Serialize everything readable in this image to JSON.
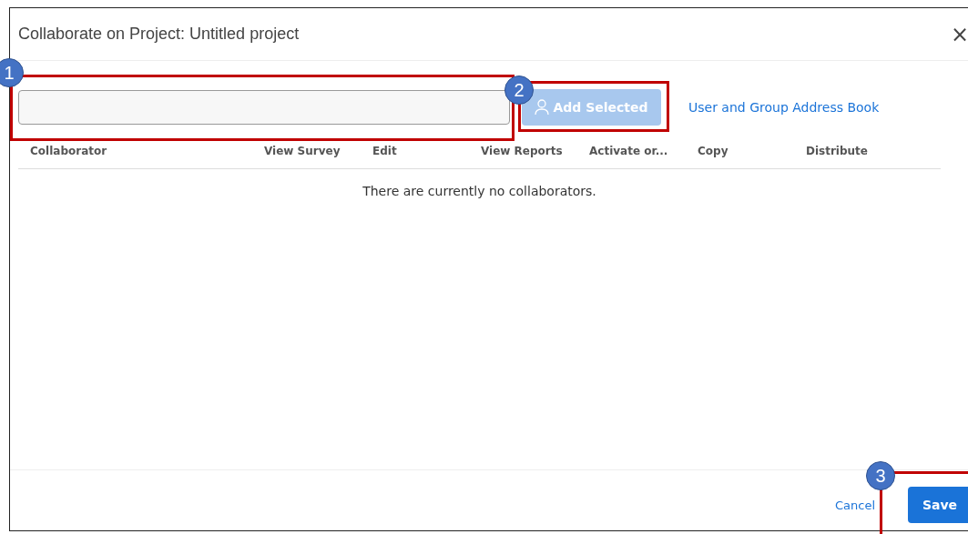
{
  "dialog": {
    "title": "Collaborate on Project: Untitled project",
    "close": "×"
  },
  "add_button": {
    "label": "Add Selected",
    "disabled": true
  },
  "address_book_link": "User and Group Address Book",
  "table": {
    "columns": [
      "Collaborator",
      "View Survey",
      "Edit",
      "View Reports",
      "Activate or...",
      "Copy",
      "Distribute"
    ],
    "empty_message": "There are currently no collaborators."
  },
  "footer": {
    "cancel": "Cancel",
    "save": "Save"
  },
  "annotations": [
    {
      "label": "1"
    },
    {
      "label": "2"
    },
    {
      "label": "3"
    }
  ]
}
